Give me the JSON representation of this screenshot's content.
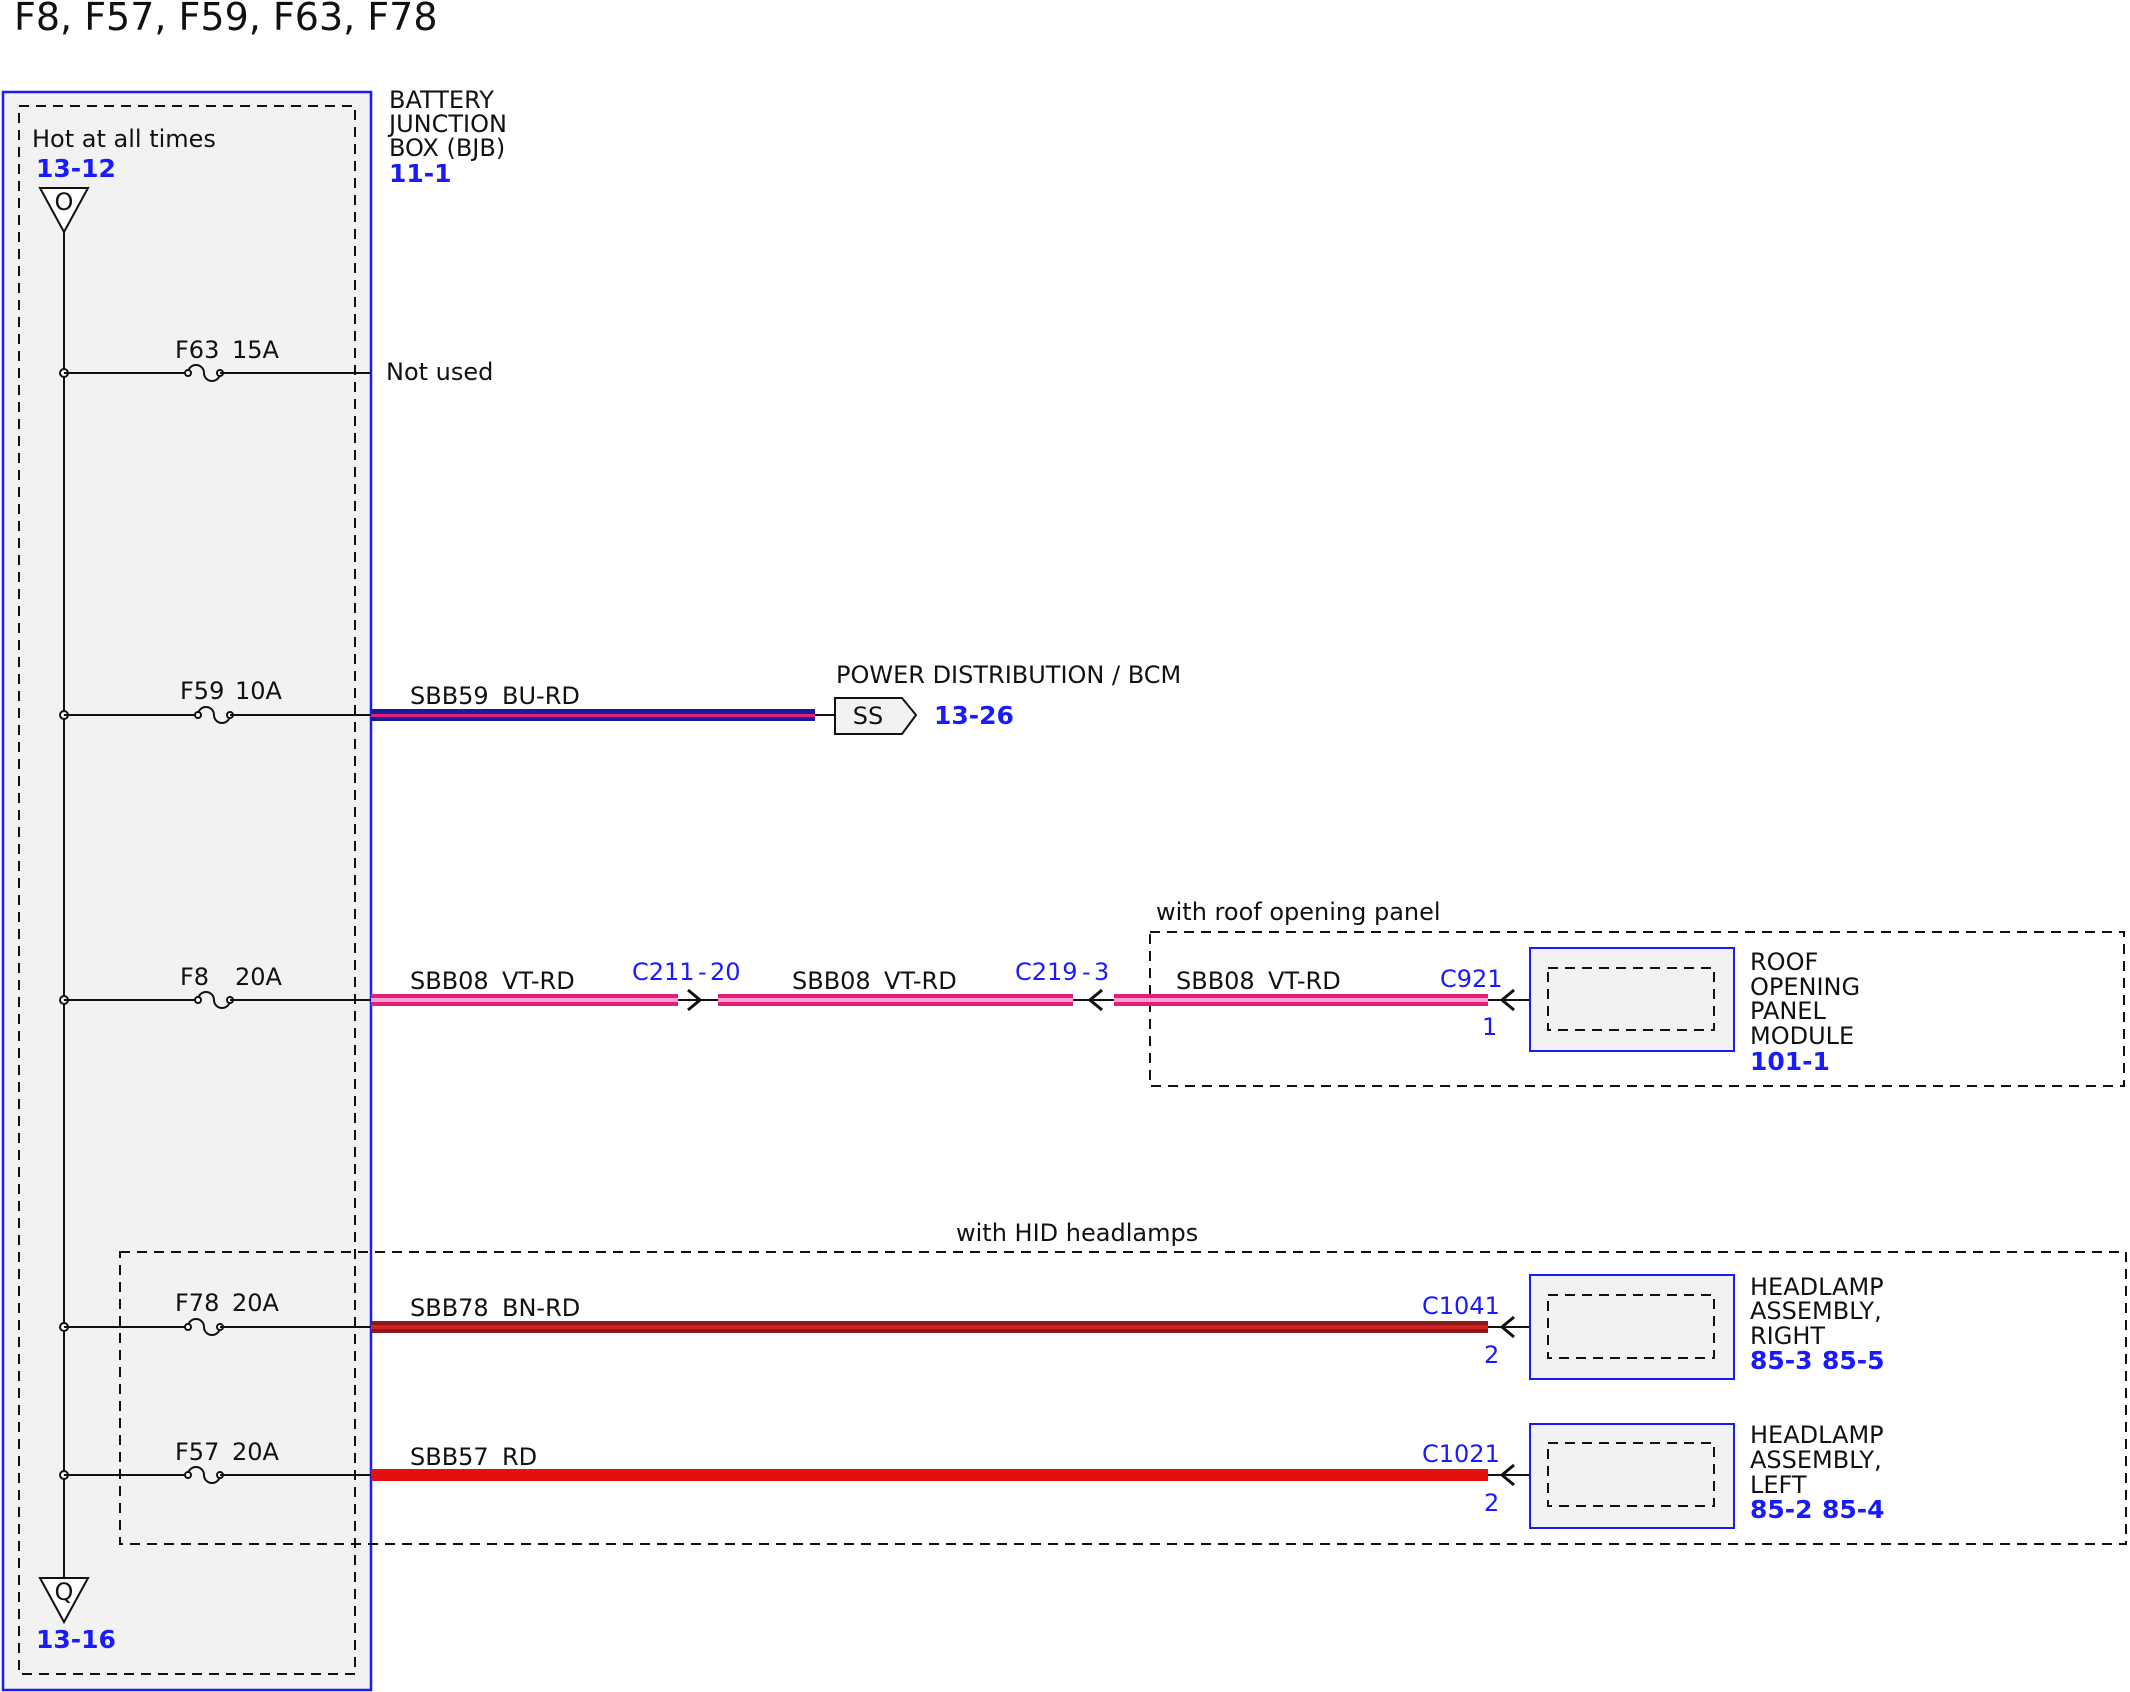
{
  "title": "F8, F57, F59, F63, F78",
  "bjb": {
    "name_lines": [
      "BATTERY",
      "JUNCTION",
      "BOX (BJB)"
    ],
    "ref": "11-1",
    "hot_label": "Hot at all times",
    "top_ref": "13-12",
    "top_symbol": "O",
    "bottom_ref": "13-16",
    "bottom_symbol": "Q",
    "colors": {
      "box_border": "#1a1aff",
      "box_fill": "#f2f2f2"
    }
  },
  "fuses": [
    {
      "id": "F63",
      "rating": "15A",
      "output": "Not used"
    },
    {
      "id": "F59",
      "rating": "10A"
    },
    {
      "id": "F8",
      "rating": "20A"
    },
    {
      "id": "F78",
      "rating": "20A"
    },
    {
      "id": "F57",
      "rating": "20A"
    }
  ],
  "wires": {
    "sbb59": {
      "circuit": "SBB59",
      "color_code": "BU-RD",
      "colors": [
        "#1a1a9a",
        "#e0207a"
      ]
    },
    "sbb08_a": {
      "circuit": "SBB08",
      "color_code": "VT-RD"
    },
    "sbb08_b": {
      "circuit": "SBB08",
      "color_code": "VT-RD"
    },
    "sbb08_c": {
      "circuit": "SBB08",
      "color_code": "VT-RD"
    },
    "sbb08_colors": [
      "#e0207a",
      "#f5a0d0"
    ],
    "sbb78": {
      "circuit": "SBB78",
      "color_code": "BN-RD",
      "colors": [
        "#8b1a1a",
        "#d02020"
      ]
    },
    "sbb57": {
      "circuit": "SBB57",
      "color_code": "RD",
      "colors": [
        "#e41010"
      ]
    }
  },
  "power_distribution": {
    "label": "POWER DISTRIBUTION / BCM",
    "symbol": "SS",
    "ref": "13-26"
  },
  "inline_connectors": [
    {
      "id": "C211",
      "pin": "20"
    },
    {
      "id": "C219",
      "pin": "3"
    }
  ],
  "roof": {
    "option_label": "with roof opening panel",
    "connector": "C921",
    "pin": "1",
    "module_lines": [
      "ROOF",
      "OPENING",
      "PANEL",
      "MODULE"
    ],
    "ref": "101-1"
  },
  "hid": {
    "option_label": "with HID headlamps",
    "right": {
      "connector": "C1041",
      "pin": "2",
      "name_lines": [
        "HEADLAMP",
        "ASSEMBLY,",
        "RIGHT"
      ],
      "refs": [
        "85-3",
        "85-5"
      ]
    },
    "left": {
      "connector": "C1021",
      "pin": "2",
      "name_lines": [
        "HEADLAMP",
        "ASSEMBLY,",
        "LEFT"
      ],
      "refs": [
        "85-2",
        "85-4"
      ]
    }
  }
}
